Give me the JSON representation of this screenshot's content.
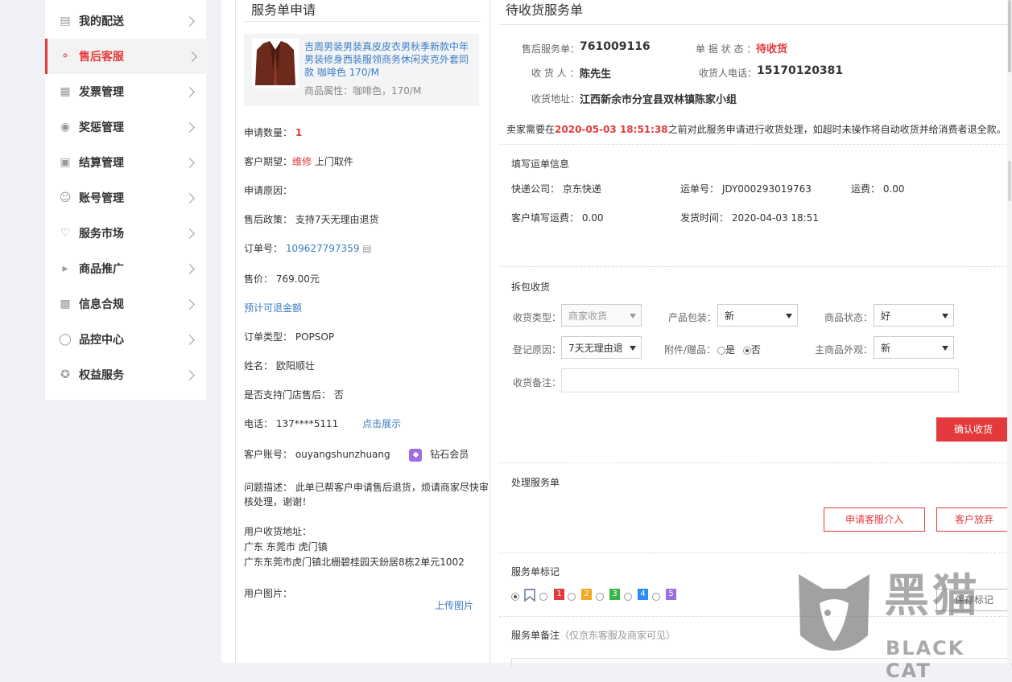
{
  "sidebar": {
    "items": [
      {
        "label": "我的配送",
        "icon": "delivery-icon"
      },
      {
        "label": "售后客服",
        "icon": "headset-icon",
        "active": true
      },
      {
        "label": "发票管理",
        "icon": "invoice-icon"
      },
      {
        "label": "奖惩管理",
        "icon": "award-icon"
      },
      {
        "label": "结算管理",
        "icon": "settlement-icon"
      },
      {
        "label": "账号管理",
        "icon": "account-icon"
      },
      {
        "label": "服务市场",
        "icon": "heart-icon"
      },
      {
        "label": "商品推广",
        "icon": "megaphone-icon"
      },
      {
        "label": "信息合规",
        "icon": "compliance-icon"
      },
      {
        "label": "品控中心",
        "icon": "shield-icon"
      },
      {
        "label": "权益服务",
        "icon": "badge-icon"
      }
    ]
  },
  "application": {
    "title": "服务单申请",
    "product": {
      "name": "吉周男装男装真皮皮衣男秋季新款中年男装修身西装服领商务休闲夹克外套同款 咖啡色 170/M",
      "attr_label": "商品属性：",
      "attr_value": "咖啡色，170/M"
    },
    "qty_label": "申请数量：",
    "qty_value": "1",
    "expect_label": "客户期望：",
    "expect_type": "维修",
    "expect_method": "上门取件",
    "reason_label": "申请原因：",
    "policy_label": "售后政策：",
    "policy_value": "支持7天无理由退货",
    "order_label": "订单号：",
    "order_value": "109627797359",
    "price_label": "售价：",
    "price_value": "769.00元",
    "refund_link": "预计可退金额",
    "order_type_label": "订单类型：",
    "order_type_value": "POPSOP",
    "name_label": "姓名：",
    "name_value": "欧阳顺壮",
    "store_label": "是否支持门店售后：",
    "store_value": "否",
    "phone_label": "电话：",
    "phone_value": "137****5111",
    "phone_link": "点击展示",
    "account_label": "客户账号：",
    "account_value": "ouyangshunzhuang",
    "member_level": "钻石会员",
    "desc_label": "问题描述：",
    "desc_value_1": "此单已帮客户申请售后退货，烦请商家尽快审",
    "desc_value_2": "核处理，谢谢！",
    "addr_label": "用户收货地址：",
    "addr_line1": "广东 东莞市 虎门镇",
    "addr_line2": "广东东莞市虎门镇北栅碧桂园天鈖居8栋2单元1002",
    "images_label": "用户图片：",
    "upload_link": "上传图片"
  },
  "service": {
    "title": "待收货服务单",
    "service_no_label": "售后服务单：",
    "service_no": "761009116",
    "status_label": "单 据 状 态 ：",
    "status_value": "待收货",
    "receiver_label": "收 货 人 ：",
    "receiver_value": "陈先生",
    "receiver_phone_label": "收货人电话：",
    "receiver_phone_value": "15170120381",
    "address_label": "收货地址：",
    "address_value": "江西新余市分宜县双林镇陈家小组",
    "notice_pre": "卖家需要在",
    "notice_deadline": "2020-05-03 18:51:38",
    "notice_post": "之前对此服务申请进行收货处理，如超时未操作将自动收货并给消费者退全款。",
    "shipping": {
      "title": "填写运单信息",
      "courier_label": "快递公司：",
      "courier_value": "京东快递",
      "tracking_label": "运单号：",
      "tracking_value": "JDY000293019763",
      "fee_label": "运费：",
      "fee_value": "0.00",
      "customer_fee_label": "客户填写运费：",
      "customer_fee_value": "0.00",
      "ship_time_label": "发货时间：",
      "ship_time_value": "2020-04-03 18:51"
    },
    "receive": {
      "title": "拆包收货",
      "type_label": "收货类型：",
      "type_value": "商家收货",
      "package_label": "产品包装：",
      "package_value": "新",
      "goods_status_label": "商品状态：",
      "goods_status_value": "好",
      "reason_label": "登记原因：",
      "reason_value": "7天无理由退",
      "accessory_label": "附件/赠品：",
      "accessory_yes": "是",
      "accessory_no": "否",
      "appearance_label": "主商品外观：",
      "appearance_value": "新",
      "remark_label": "收货备注：",
      "confirm_button": "确认收货"
    },
    "process": {
      "title": "处理服务单",
      "intervene_button": "申请客服介入",
      "abandon_button": "客户放弃"
    },
    "marks": {
      "title": "服务单标记",
      "flags": [
        "1",
        "2",
        "3",
        "4",
        "5"
      ],
      "flag_colors": [
        "#e4393c",
        "#f5a623",
        "#3bb54a",
        "#2d8cf0",
        "#9b6fdc"
      ],
      "save_button": "保存标记"
    },
    "remark": {
      "title": "服务单备注",
      "hint": "（仅京东客服及商家可见）"
    }
  },
  "watermark": {
    "cn": "黑猫",
    "en": "BLACK CAT"
  }
}
